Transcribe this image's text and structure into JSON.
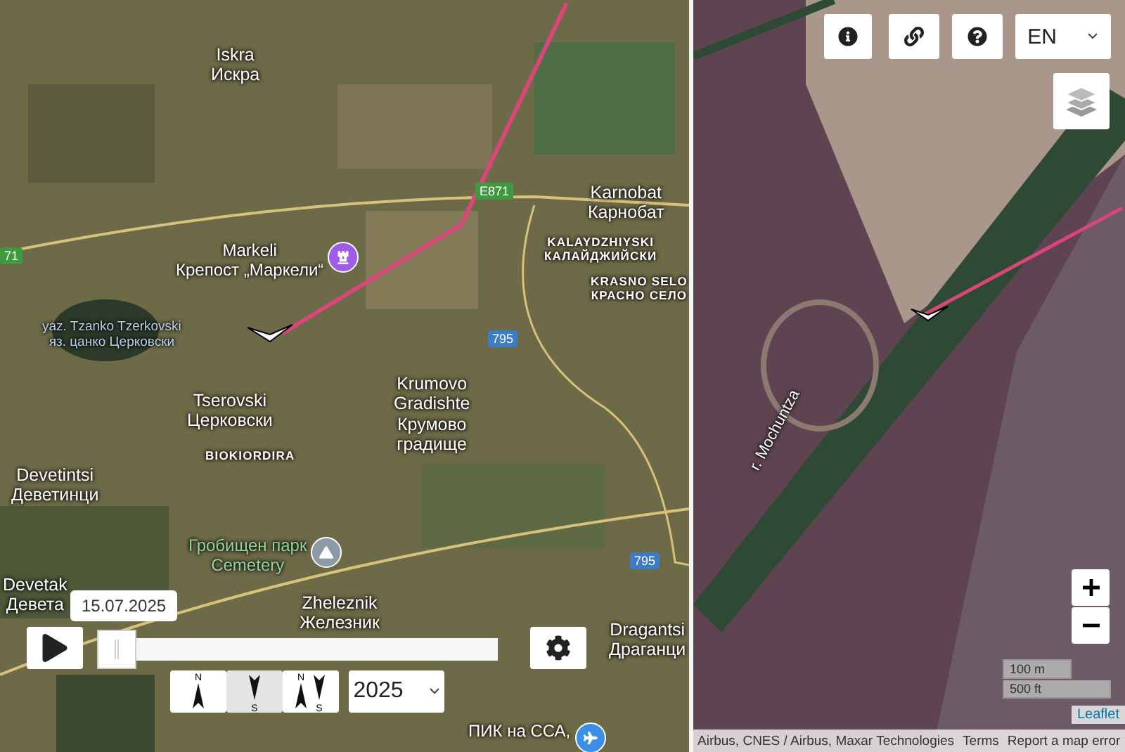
{
  "left_map": {
    "labels": [
      {
        "kind": "town",
        "lines": [
          "Iskra",
          "Искра"
        ]
      },
      {
        "kind": "shield_green",
        "lines": [
          "E871"
        ]
      },
      {
        "kind": "shield_green",
        "lines": [
          "71"
        ]
      },
      {
        "kind": "town",
        "lines": [
          "Karnobat",
          "Карнобат"
        ]
      },
      {
        "kind": "district",
        "lines": [
          "KALAYDZHIYSKI",
          "КАЛАЙДЖИЙСКИ"
        ]
      },
      {
        "kind": "district",
        "lines": [
          "KRASNO SELO",
          "КРАСНО СЕЛО"
        ]
      },
      {
        "kind": "poi_castle",
        "lines": [
          "Markeli",
          "Крепост „Маркели“"
        ]
      },
      {
        "kind": "water",
        "lines": [
          "yaz. Tzanko Tzerkovski",
          "яз. цанко Церковски"
        ]
      },
      {
        "kind": "shield_blue",
        "lines": [
          "795"
        ]
      },
      {
        "kind": "town",
        "lines": [
          "Tserovski",
          "Церковски"
        ]
      },
      {
        "kind": "town",
        "lines": [
          "Krumovo",
          "Gradishte",
          "Крумово",
          "градище"
        ]
      },
      {
        "kind": "district",
        "lines": [
          "BIOKIORDIRA"
        ]
      },
      {
        "kind": "town",
        "lines": [
          "Devetintsi",
          "Деветинци"
        ]
      },
      {
        "kind": "poi_cemetery",
        "lines": [
          "Гробищен парк",
          "Cemetery"
        ]
      },
      {
        "kind": "shield_blue",
        "lines": [
          "795"
        ]
      },
      {
        "kind": "town",
        "lines": [
          "Devetak",
          "Девета"
        ]
      },
      {
        "kind": "town",
        "lines": [
          "Zheleznik",
          "Железник"
        ]
      },
      {
        "kind": "town",
        "lines": [
          "Dragantsi",
          "Драганци"
        ]
      },
      {
        "kind": "poi_airport",
        "lines": [
          "ПИК на ССА,"
        ]
      }
    ]
  },
  "right_map": {
    "labels": [
      {
        "kind": "river",
        "lines": [
          "r. Mochuntza"
        ]
      }
    ]
  },
  "timeline": {
    "date": "15.07.2025",
    "level": 0.0
  },
  "orientations": [
    {
      "north": "N",
      "selected": false
    },
    {
      "south": "S",
      "selected": true
    },
    {
      "north": "N",
      "south": "S",
      "selected": false
    }
  ],
  "year": "2025",
  "language": "EN",
  "scale": [
    "100 m",
    "500 ft"
  ],
  "leaflet": "Leaflet",
  "attribution": "Airbus, CNES / Airbus, Maxar Technologies",
  "footer_links": [
    "Terms",
    "Report a map error"
  ]
}
